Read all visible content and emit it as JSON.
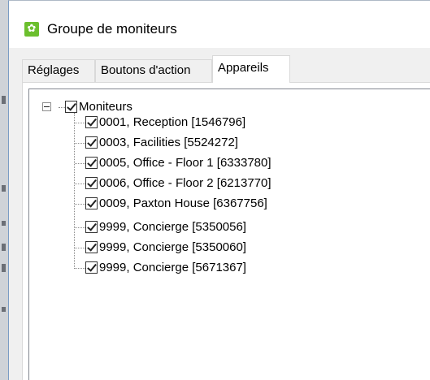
{
  "window": {
    "title": "Groupe de moniteurs",
    "icon": "app-icon"
  },
  "tabs": [
    {
      "label": "Réglages",
      "active": false
    },
    {
      "label": "Boutons d'action",
      "active": false
    },
    {
      "label": "Appareils",
      "active": true
    }
  ],
  "tree": {
    "root": {
      "label": "Moniteurs",
      "checked": true,
      "expanded": true
    },
    "children": [
      {
        "label": "0001, Reception [1546796]",
        "checked": true
      },
      {
        "label": "0003, Facilities [5524272]",
        "checked": true
      },
      {
        "label": "0005, Office - Floor 1 [6333780]",
        "checked": true
      },
      {
        "label": "0006, Office - Floor 2 [6213770]",
        "checked": true
      },
      {
        "label": "0009, Paxton House [6367756]",
        "checked": true
      },
      {
        "label": "9999, Concierge [5350056]",
        "checked": true
      },
      {
        "label": "9999, Concierge [5350060]",
        "checked": true
      },
      {
        "label": "9999, Concierge [5671367]",
        "checked": true
      }
    ]
  },
  "colors": {
    "accent": "#6cbf2e",
    "window_bg": "#f0f0f0",
    "tab_border": "#d9d9d9"
  }
}
